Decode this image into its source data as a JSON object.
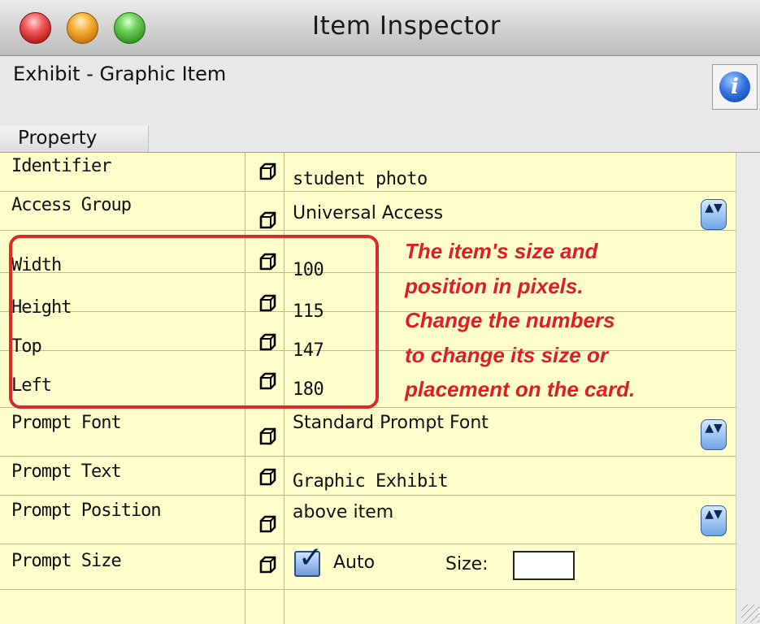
{
  "window": {
    "title": "Item Inspector",
    "buttons": [
      "close",
      "minimize",
      "zoom"
    ]
  },
  "header": {
    "item_type": "Exhibit - Graphic Item",
    "info_icon": "info-icon",
    "info_glyph": "i",
    "column_header": "Property"
  },
  "properties": [
    {
      "name": "Identifier",
      "value": "student photo",
      "control": "text"
    },
    {
      "name": "Access Group",
      "value": "Universal Access",
      "control": "popup"
    },
    {
      "name": "Width",
      "value": "100",
      "control": "text"
    },
    {
      "name": "Height",
      "value": "115",
      "control": "text"
    },
    {
      "name": "Top",
      "value": "147",
      "control": "text"
    },
    {
      "name": "Left",
      "value": "180",
      "control": "text"
    },
    {
      "name": "Prompt Font",
      "value": "Standard Prompt Font",
      "control": "popup"
    },
    {
      "name": "Prompt Text",
      "value": "Graphic Exhibit",
      "control": "text"
    },
    {
      "name": "Prompt Position",
      "value": "above item",
      "control": "popup"
    },
    {
      "name": "Prompt Size",
      "auto_label": "Auto",
      "auto_checked": true,
      "size_label": "Size:",
      "size_value": "",
      "control": "checkbox"
    }
  ],
  "annotation": {
    "lines": [
      "The item's size and",
      "position in pixels.",
      "Change the numbers",
      "to change its size or",
      "placement on the card."
    ],
    "color": "#e11d24"
  },
  "icons": {
    "cube": "cube-icon",
    "popup": "popup-arrows-icon",
    "popup_glyph": "▲▼",
    "check_glyph": "✓"
  }
}
